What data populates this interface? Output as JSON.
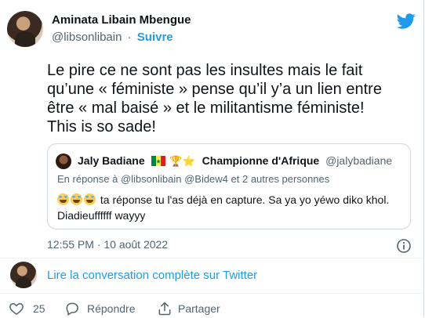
{
  "author": {
    "name": "Aminata Libain Mbengue",
    "handle": "@libsonlibain",
    "separator": "·",
    "follow_label": "Suivre"
  },
  "tweet": {
    "paragraph1": "Le pire ce ne sont pas les insultes mais le fait qu’une « féministe » pense qu’il y’a un lien entre être « mal baisé » et le militantisme féministe!",
    "paragraph2": "This is so sade!"
  },
  "quote": {
    "name": "Jaly Badiane",
    "emojis": "🏆⭐",
    "title": "Championne d'Afrique",
    "handle": "@jalybadiane",
    "reply_to": "En réponse à @libsonlibain @Bidew4  et 2 autres personnes",
    "body": "ta réponse tu l'as déjà en capture. Sa ya yo yéwo diko khol. Diadieuffffff wayyy"
  },
  "timestamp": "12:55 PM · 10 août 2022",
  "conversation_link": "Lire la conversation complète sur Twitter",
  "actions": {
    "like_count": "25",
    "reply_label": "Répondre",
    "share_label": "Partager"
  },
  "colors": {
    "twitter_blue": "#1d9bf0",
    "secondary_text": "#536471",
    "border": "#cfd9de"
  },
  "icons": {
    "brand": "twitter-bird-icon",
    "info": "info-icon",
    "like": "heart-icon",
    "reply": "reply-bubble-icon",
    "share": "share-icon"
  }
}
